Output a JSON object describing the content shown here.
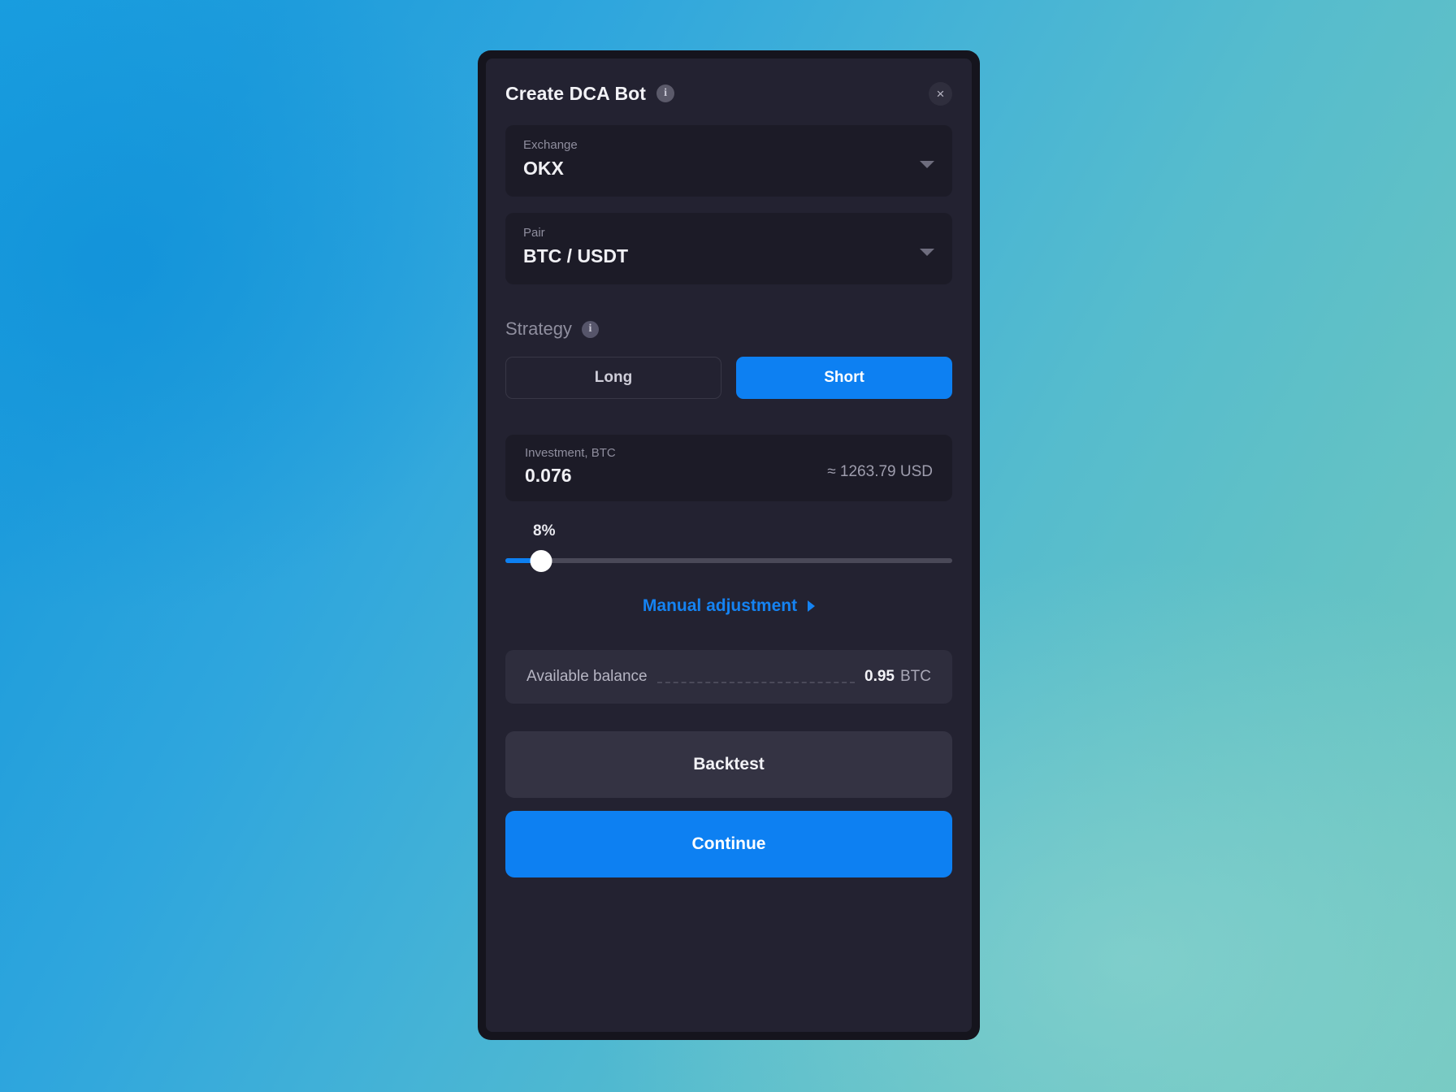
{
  "theme": {
    "accent": "#0d80f2",
    "panel_bg": "#232231",
    "field_bg": "#1c1b27",
    "border": "#15141d",
    "balance_bg": "#2e2d3d",
    "text_primary": "#f0f0f4",
    "text_muted": "#8f8e9e"
  },
  "header": {
    "title": "Create DCA Bot",
    "info_icon": "info-icon",
    "close_icon": "×"
  },
  "exchange": {
    "label": "Exchange",
    "value": "OKX",
    "caret_icon": "chevron-down-icon"
  },
  "pair": {
    "label": "Pair",
    "value": "BTC / USDT",
    "caret_icon": "chevron-down-icon"
  },
  "strategy": {
    "label": "Strategy",
    "info_icon": "info-icon",
    "options": [
      {
        "label": "Long",
        "selected": false
      },
      {
        "label": "Short",
        "selected": true
      }
    ],
    "selected": "Short"
  },
  "investment": {
    "label": "Investment, BTC",
    "value": "0.076",
    "approx": "≈ 1263.79 USD",
    "currency": "BTC"
  },
  "slider": {
    "value_label": "8%",
    "percent": 8,
    "min": 0,
    "max": 100
  },
  "manual_adjustment": {
    "label": "Manual adjustment",
    "caret_icon": "chevron-right-icon"
  },
  "balance": {
    "label": "Available balance",
    "amount": "0.95",
    "unit": "BTC"
  },
  "footer": {
    "backtest_label": "Backtest",
    "continue_label": "Continue"
  }
}
